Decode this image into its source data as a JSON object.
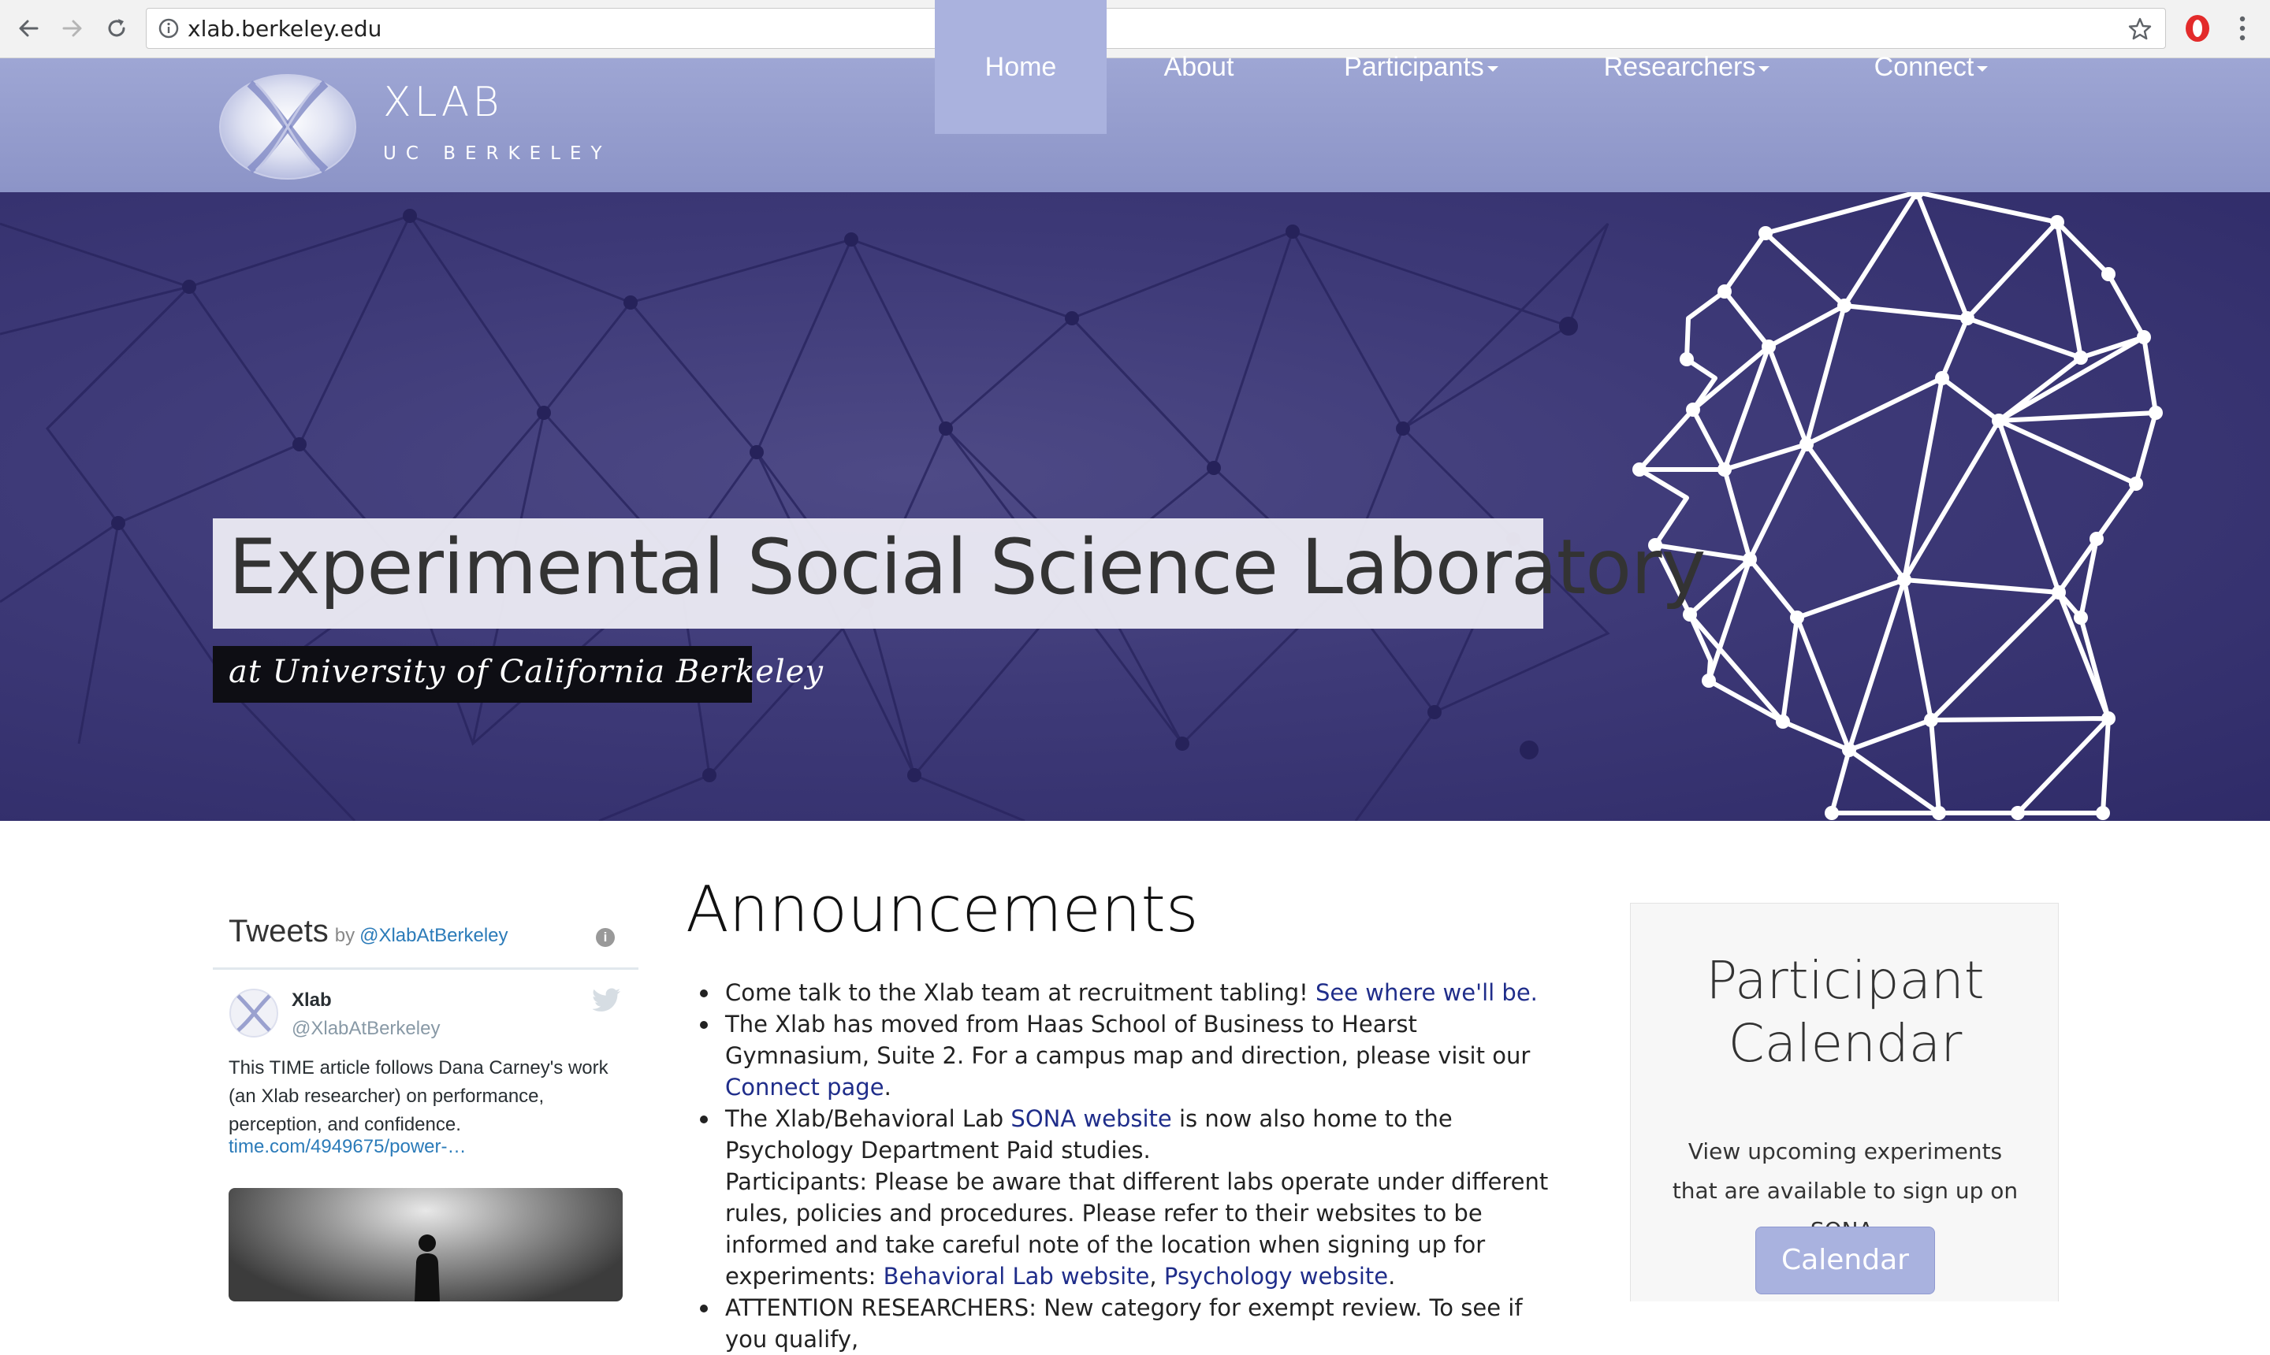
{
  "browser": {
    "url": "xlab.berkeley.edu",
    "back_icon": "back-arrow-icon",
    "forward_icon": "forward-arrow-icon",
    "reload_icon": "reload-icon",
    "info_icon": "info-circle-icon",
    "bookmark_icon": "star-icon",
    "extension_icon": "opera-icon",
    "menu_icon": "vertical-dots-icon"
  },
  "header": {
    "logo_title": "XLAB",
    "logo_subtitle": "UC BERKELEY",
    "nav": [
      {
        "label": "Home",
        "active": true,
        "dropdown": false
      },
      {
        "label": "About",
        "active": false,
        "dropdown": false
      },
      {
        "label": "Participants",
        "active": false,
        "dropdown": true
      },
      {
        "label": "Researchers",
        "active": false,
        "dropdown": true
      },
      {
        "label": "Connect",
        "active": false,
        "dropdown": true
      }
    ]
  },
  "hero": {
    "title": "Experimental Social Science Laboratory",
    "subtitle": "at University of California Berkeley"
  },
  "tweets": {
    "heading": "Tweets",
    "by": "by",
    "handle_link": "@XlabAtBerkeley",
    "info_symbol": "i",
    "tweet": {
      "name": "Xlab",
      "username": "@XlabAtBerkeley",
      "text": "This TIME article follows Dana Carney's work (an Xlab researcher) on performance, perception, and confidence.",
      "link": "time.com/4949675/power-…"
    }
  },
  "announcements": {
    "title": "Announcements",
    "item1_text": "Come talk to the Xlab team at recruitment tabling! ",
    "item1_link": "See where we'll be.",
    "item2_text": "The Xlab has moved from Haas School of Business to Hearst Gymnasium, Suite 2. For a campus map and direction, please visit our ",
    "item2_link": "Connect page",
    "item2_end": ".",
    "item3_pre": "The Xlab/Behavioral Lab ",
    "item3_link": "SONA website",
    "item3_post": " is now also home to the Psychology Department Paid studies.",
    "item3_body": "Participants: Please be aware that different labs operate under different rules, policies and procedures. Please refer to their websites to be informed and take careful note of the location when signing up for experiments: ",
    "item3_link2": "Behavioral Lab website",
    "item3_sep": ", ",
    "item3_link3": "Psychology website",
    "item3_end": ".",
    "item4_text": "ATTENTION RESEARCHERS: New category for exempt review. To see if you qualify,"
  },
  "calendar": {
    "title": "Participant Calendar",
    "description": "View upcoming experiments that are available to sign up on SONA.",
    "button_label": "Calendar"
  },
  "colors": {
    "header_bg": "#949cce",
    "nav_active": "#aab2de",
    "hero_bg": "#3e3a78",
    "link": "#1f2d8a",
    "twitter_link": "#2b7bb9",
    "button": "#a9b2df"
  }
}
